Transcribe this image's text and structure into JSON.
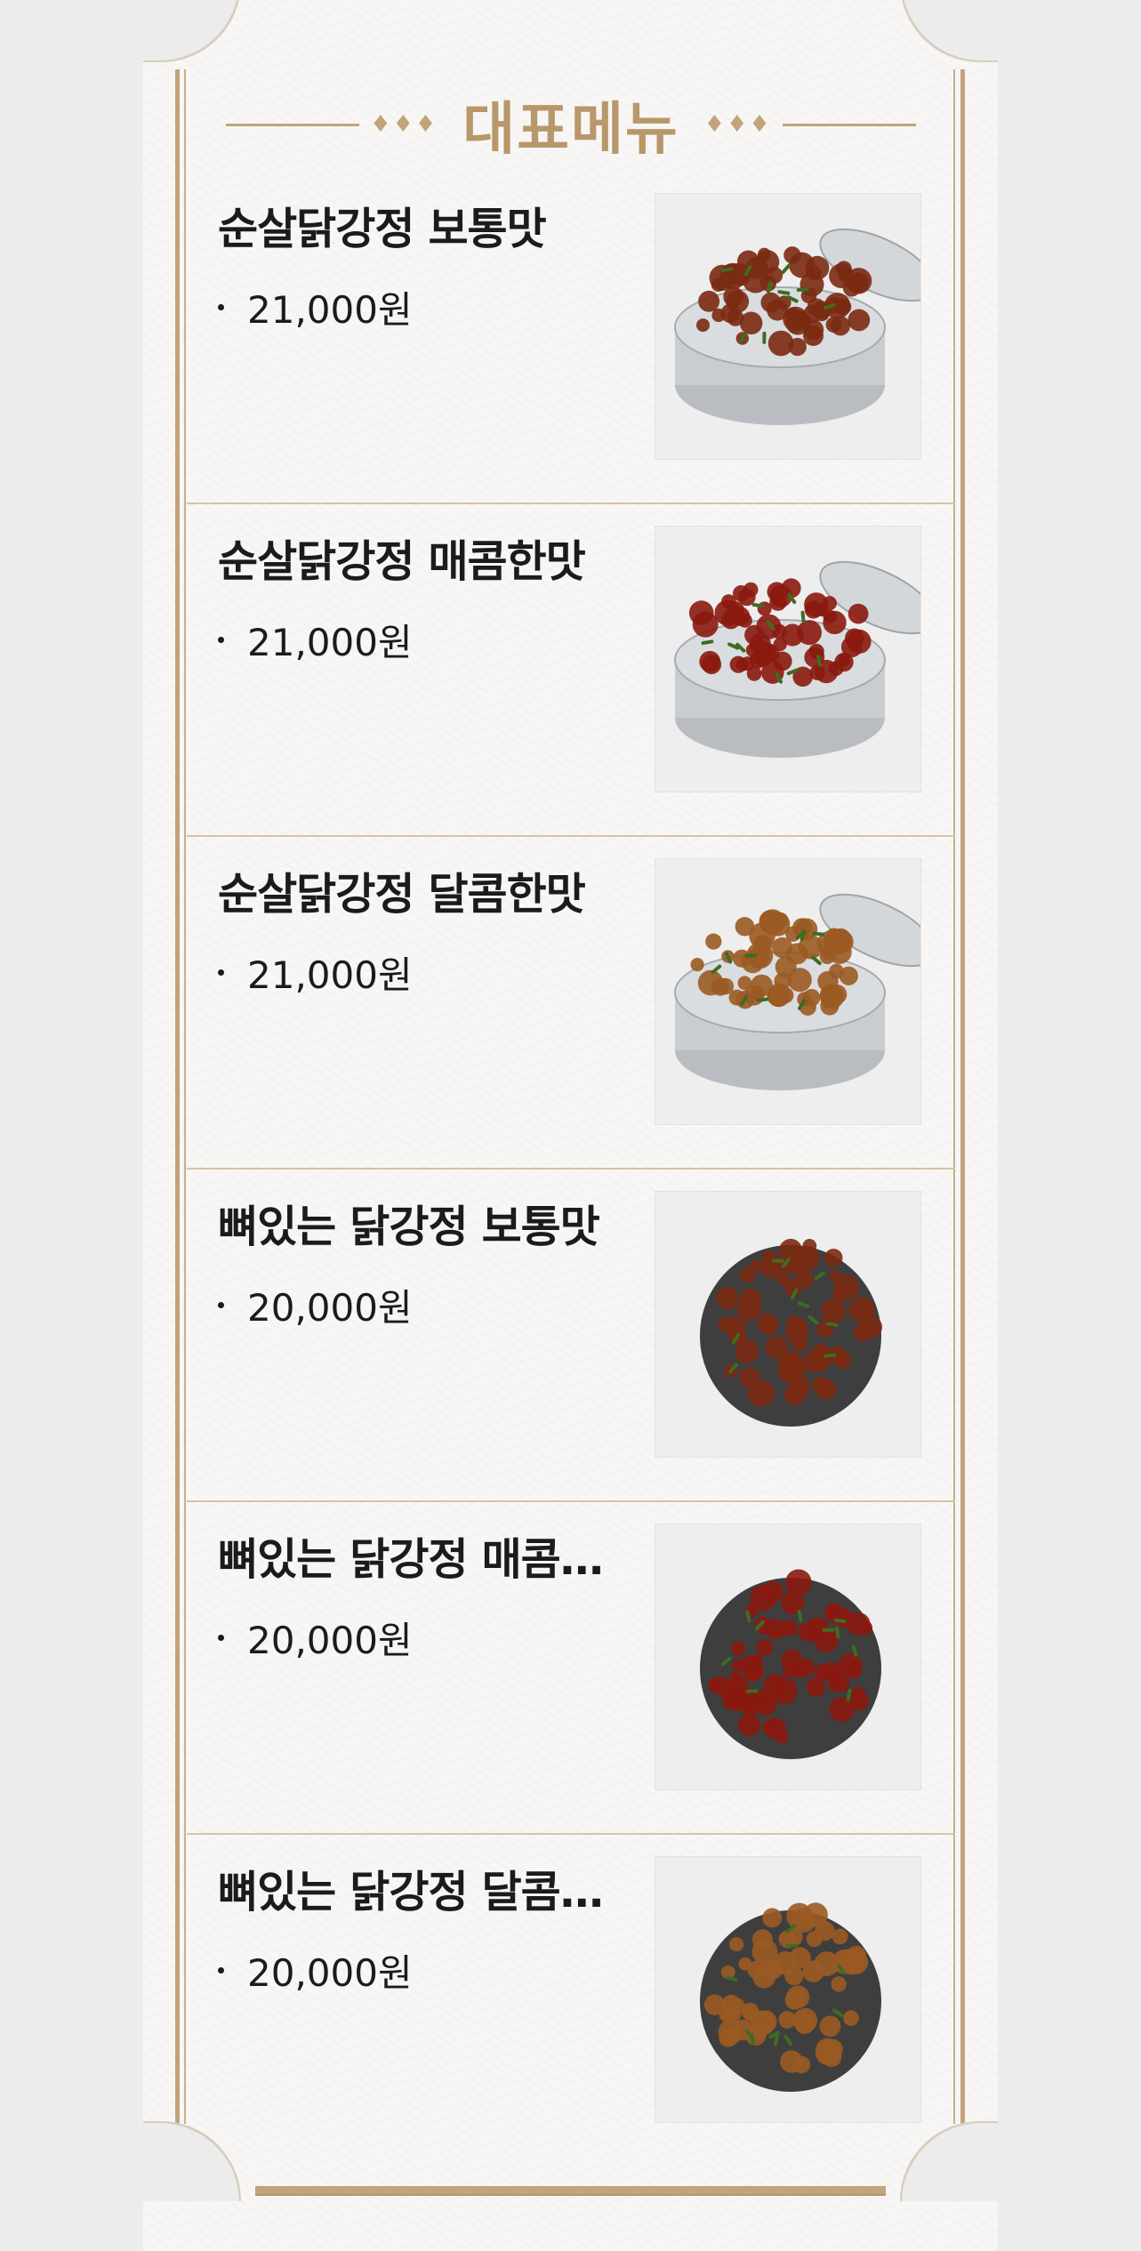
{
  "section": {
    "title": "대표메뉴",
    "ornament": "♦♦♦"
  },
  "menu": [
    {
      "name": "순살닭강정 보통맛",
      "price": "21,000원",
      "image": "food-tin-plain-chicken",
      "sauce": "#7a2a12"
    },
    {
      "name": "순살닭강정 매콤한맛",
      "price": "21,000원",
      "image": "food-tin-spicy-chicken",
      "sauce": "#8a1a10"
    },
    {
      "name": "순살닭강정 달콤한맛",
      "price": "21,000원",
      "image": "food-tin-sweet-chicken",
      "sauce": "#9a5a22"
    },
    {
      "name": "뼈있는 닭강정 보통맛",
      "price": "20,000원",
      "image": "food-bowl-plain-chicken",
      "sauce": "#7a2a12"
    },
    {
      "name": "뼈있는 닭강정 매콤한맛",
      "price": "20,000원",
      "image": "food-bowl-spicy-chicken",
      "sauce": "#8a1a10"
    },
    {
      "name": "뼈있는 닭강정 달콤한맛",
      "price": "20,000원",
      "image": "food-bowl-sweet-chicken",
      "sauce": "#9a5a22"
    }
  ],
  "colors": {
    "gold": "#c2a37a",
    "heading": "#b8976a",
    "divider": "#d6c2a5"
  }
}
